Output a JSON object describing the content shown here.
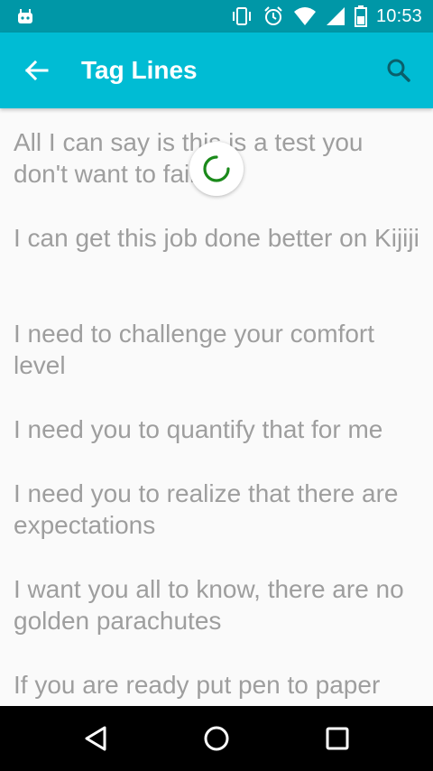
{
  "status_bar": {
    "time": "10:53",
    "icons": [
      "android-icon",
      "vibrate-icon",
      "alarm-icon",
      "wifi-icon",
      "signal-icon",
      "battery-icon"
    ]
  },
  "app_bar": {
    "title": "Tag Lines",
    "back_icon": "arrow-back-icon",
    "search_icon": "search-icon",
    "background": "#00bcd4"
  },
  "list": {
    "items": [
      "All I can say is this is a test you don't want to fail",
      "I can get this job done better on Kijiji",
      "I need to challenge your comfort level",
      "I need you to quantify that for me",
      "I need you to realize that there are expectations",
      "I want you all to know, there are no golden parachutes",
      "If you are ready put pen to paper"
    ],
    "text_color": "#9e9e9e"
  },
  "loading": {
    "accent": "#1b8a1b"
  },
  "nav_bar": {
    "icons": [
      "back-triangle-icon",
      "home-circle-icon",
      "recents-square-icon"
    ]
  }
}
